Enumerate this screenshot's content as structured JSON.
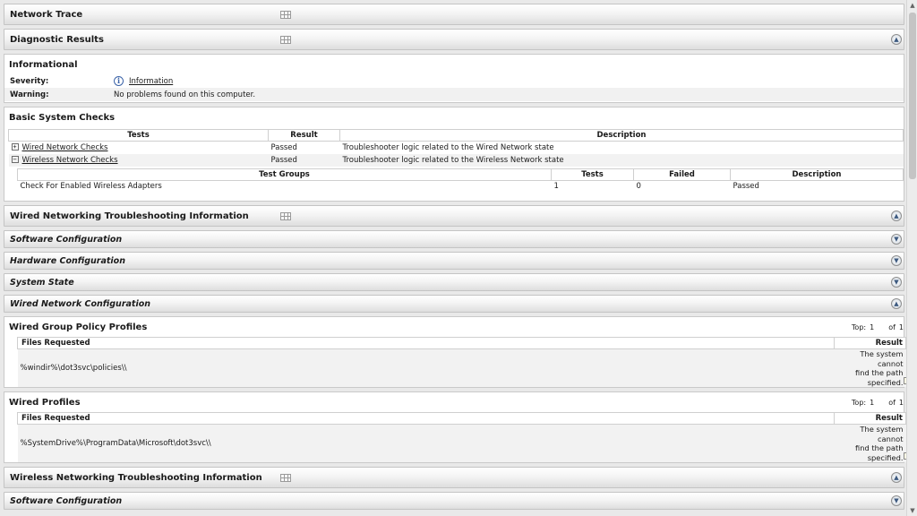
{
  "sections": {
    "network_trace": "Network Trace",
    "diagnostic_results": "Diagnostic Results",
    "wired_troubleshooting": "Wired Networking Troubleshooting Information",
    "software_configuration": "Software Configuration",
    "hardware_configuration": "Hardware Configuration",
    "system_state": "System State",
    "wired_network_configuration": "Wired Network Configuration",
    "wireless_troubleshooting": "Wireless Networking Troubleshooting Information",
    "software_configuration_2": "Software Configuration"
  },
  "informational": {
    "title": "Informational",
    "severity_label": "Severity:",
    "severity_value": "Information",
    "warning_label": "Warning:",
    "warning_value": "No problems found on this computer."
  },
  "basic_checks": {
    "title": "Basic System Checks",
    "headers": [
      "Tests",
      "Result",
      "Description"
    ],
    "rows": [
      {
        "test": "Wired Network Checks",
        "toggle": "+",
        "result": "Passed",
        "description": "Troubleshooter logic related to the Wired Network state"
      },
      {
        "test": "Wireless Network Checks",
        "toggle": "−",
        "result": "Passed",
        "description": "Troubleshooter logic related to the Wireless Network state"
      }
    ],
    "group_headers": [
      "Test Groups",
      "Tests",
      "Failed",
      "Description"
    ],
    "group_row": {
      "name": "Check For Enabled Wireless Adapters",
      "tests": "1",
      "failed": "0",
      "description": "Passed"
    }
  },
  "wired_gpo": {
    "title": "Wired Group Policy Profiles",
    "top_label": "Top:",
    "top_value": "1",
    "of_label": "of",
    "of_value": "1",
    "headers": [
      "Files Requested",
      "Result"
    ],
    "file": "%windir%\\dot3svc\\policies\\\\",
    "result_lines": [
      "The system cannot",
      "find the path",
      "specified."
    ]
  },
  "wired_profiles": {
    "title": "Wired Profiles",
    "top_label": "Top:",
    "top_value": "1",
    "of_label": "of",
    "of_value": "1",
    "headers": [
      "Files Requested",
      "Result"
    ],
    "file": "%SystemDrive%\\ProgramData\\Microsoft\\dot3svc\\\\",
    "result_lines": [
      "The system cannot",
      "find the path",
      "specified."
    ]
  },
  "icons": {
    "expand": "▼",
    "collapse": "▲",
    "scroll_up": "▲",
    "scroll_down": "▼"
  }
}
